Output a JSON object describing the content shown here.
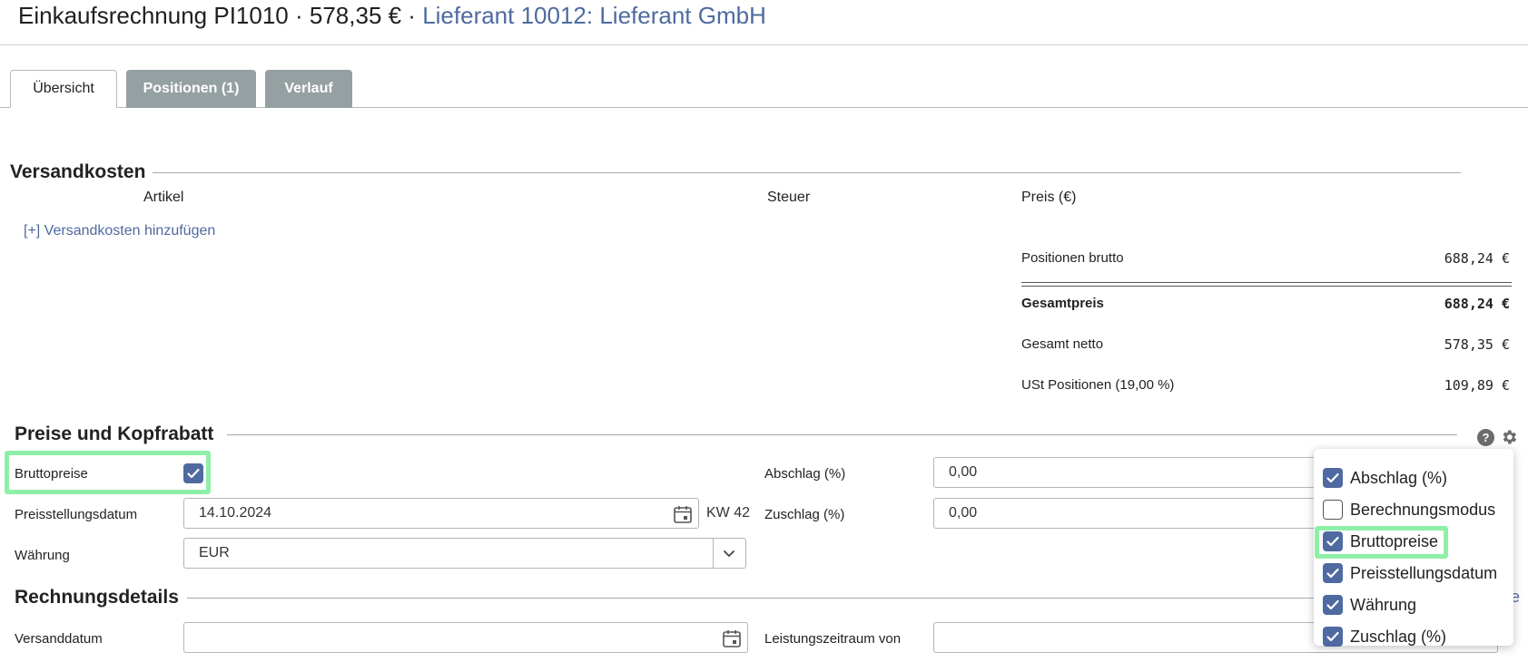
{
  "header": {
    "title_prefix": "Einkaufsrechnung PI1010 · 578,35 € · ",
    "supplier_link": "Lieferant 10012: Lieferant GmbH"
  },
  "tabs": [
    {
      "label": "Übersicht",
      "active": true
    },
    {
      "label": "Positionen (1)",
      "active": false
    },
    {
      "label": "Verlauf",
      "active": false
    }
  ],
  "shipping": {
    "title": "Versandkosten",
    "columns": [
      "Artikel",
      "Steuer",
      "Preis (€)"
    ],
    "add_link": "[+] Versandkosten hinzufügen"
  },
  "totals": [
    {
      "label": "Positionen brutto",
      "value": "688,24 €",
      "bold": false
    },
    {
      "label": "Gesamtpreis",
      "value": "688,24 €",
      "bold": true
    },
    {
      "label": "Gesamt netto",
      "value": "578,35 €",
      "bold": false
    },
    {
      "label": "USt Positionen (19,00 %)",
      "value": "109,89 €",
      "bold": false
    }
  ],
  "prices": {
    "title": "Preise und Kopfrabatt",
    "brutto_label": "Bruttopreise",
    "brutto_checked": true,
    "date_label": "Preisstellungsdatum",
    "date_value": "14.10.2024",
    "kw": "KW 42",
    "currency_label": "Währung",
    "currency_value": "EUR",
    "discount_label": "Abschlag (%)",
    "discount_value": "0,00",
    "surcharge_label": "Zuschlag (%)",
    "surcharge_value": "0,00"
  },
  "invoice_details": {
    "title": "Rechnungsdetails",
    "ship_date_label": "Versanddatum",
    "ship_date_value": "",
    "period_from_label": "Leistungszeitraum von",
    "period_from_value": ""
  },
  "column_menu": {
    "items": [
      {
        "label": "Abschlag (%)",
        "checked": true
      },
      {
        "label": "Berechnungsmodus",
        "checked": false
      },
      {
        "label": "Bruttopreise",
        "checked": true
      },
      {
        "label": "Preisstellungsdatum",
        "checked": true
      },
      {
        "label": "Währung",
        "checked": true
      },
      {
        "label": "Zuschlag (%)",
        "checked": true
      }
    ]
  },
  "colors": {
    "accent": "#4f6aa0",
    "tab_inactive": "#95a0a3",
    "highlight": "#8ef0a6"
  },
  "icons": [
    "help-icon",
    "gear-icon",
    "calendar-icon",
    "chevron-down-icon",
    "check-icon"
  ]
}
